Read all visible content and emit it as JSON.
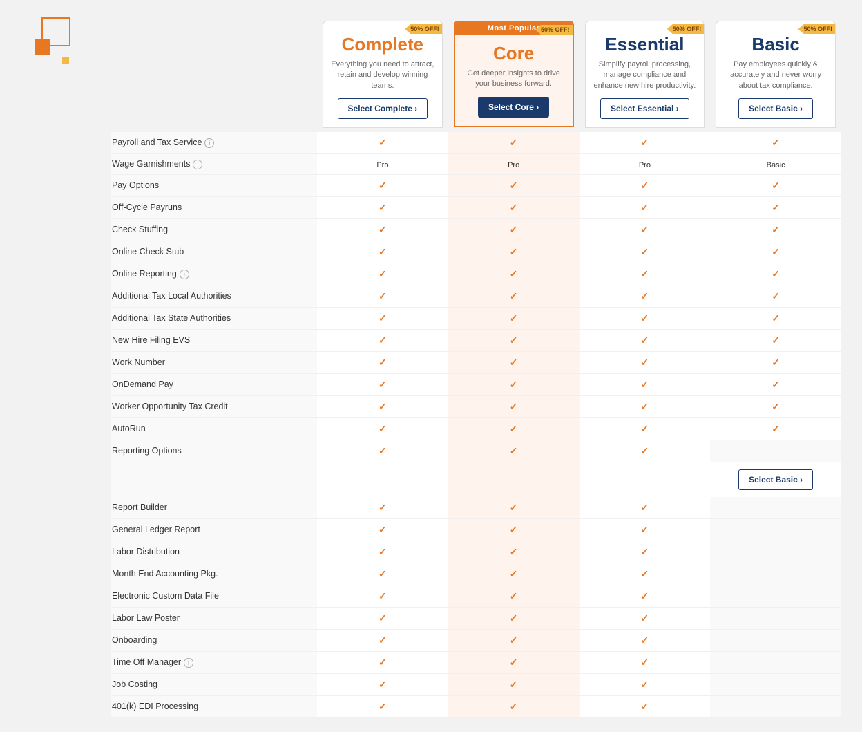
{
  "deco": {
    "visible": true
  },
  "plans": [
    {
      "id": "complete",
      "name": "Complete",
      "description": "Everything you need to attract, retain and develop winning teams.",
      "discount": "50% OFF!",
      "select_label": "Select Complete",
      "most_popular": false,
      "color": "orange"
    },
    {
      "id": "core",
      "name": "Core",
      "description": "Get deeper insights to drive your business forward.",
      "discount": "50% OFF!",
      "select_label": "Select Core",
      "most_popular": true,
      "color": "orange"
    },
    {
      "id": "essential",
      "name": "Essential",
      "description": "Simplify payroll processing, manage compliance and enhance new hire productivity.",
      "discount": "50% OFF!",
      "select_label": "Select Essential",
      "most_popular": false,
      "color": "navy"
    },
    {
      "id": "basic",
      "name": "Basic",
      "description": "Pay employees quickly & accurately and never worry about tax compliance.",
      "discount": "50% OFF!",
      "select_label": "Select Basic",
      "most_popular": false,
      "color": "navy"
    }
  ],
  "most_popular_label": "Most Popular",
  "features": [
    {
      "name": "Payroll and Tax Service",
      "info": true,
      "complete": "check",
      "core": "check",
      "essential": "check",
      "basic": "check"
    },
    {
      "name": "Wage Garnishments",
      "info": true,
      "complete": "Pro",
      "core": "Pro",
      "essential": "Pro",
      "basic": "Basic"
    },
    {
      "name": "Pay Options",
      "info": false,
      "complete": "check",
      "core": "check",
      "essential": "check",
      "basic": "check"
    },
    {
      "name": "Off-Cycle Payruns",
      "info": false,
      "complete": "check",
      "core": "check",
      "essential": "check",
      "basic": "check"
    },
    {
      "name": "Check Stuffing",
      "info": false,
      "complete": "check",
      "core": "check",
      "essential": "check",
      "basic": "check"
    },
    {
      "name": "Online Check Stub",
      "info": false,
      "complete": "check",
      "core": "check",
      "essential": "check",
      "basic": "check"
    },
    {
      "name": "Online Reporting",
      "info": true,
      "complete": "check",
      "core": "check",
      "essential": "check",
      "basic": "check"
    },
    {
      "name": "Additional Tax Local Authorities",
      "info": false,
      "complete": "check",
      "core": "check",
      "essential": "check",
      "basic": "check"
    },
    {
      "name": "Additional Tax State Authorities",
      "info": false,
      "complete": "check",
      "core": "check",
      "essential": "check",
      "basic": "check"
    },
    {
      "name": "New Hire Filing EVS",
      "info": false,
      "complete": "check",
      "core": "check",
      "essential": "check",
      "basic": "check"
    },
    {
      "name": "Work Number",
      "info": false,
      "complete": "check",
      "core": "check",
      "essential": "check",
      "basic": "check"
    },
    {
      "name": "OnDemand Pay",
      "info": false,
      "complete": "check",
      "core": "check",
      "essential": "check",
      "basic": "check"
    },
    {
      "name": "Worker Opportunity Tax Credit",
      "info": false,
      "complete": "check",
      "core": "check",
      "essential": "check",
      "basic": "check"
    },
    {
      "name": "AutoRun",
      "info": false,
      "complete": "check",
      "core": "check",
      "essential": "check",
      "basic": "check"
    },
    {
      "name": "Reporting Options",
      "info": false,
      "complete": "check",
      "core": "check",
      "essential": "check",
      "basic": ""
    },
    {
      "name": "Report Builder",
      "info": false,
      "complete": "check",
      "core": "check",
      "essential": "check",
      "basic": ""
    },
    {
      "name": "General Ledger Report",
      "info": false,
      "complete": "check",
      "core": "check",
      "essential": "check",
      "basic": ""
    },
    {
      "name": "Labor Distribution",
      "info": false,
      "complete": "check",
      "core": "check",
      "essential": "check",
      "basic": ""
    },
    {
      "name": "Month End Accounting Pkg.",
      "info": false,
      "complete": "check",
      "core": "check",
      "essential": "check",
      "basic": ""
    },
    {
      "name": "Electronic Custom Data File",
      "info": false,
      "complete": "check",
      "core": "check",
      "essential": "check",
      "basic": ""
    },
    {
      "name": "Labor Law Poster",
      "info": false,
      "complete": "check",
      "core": "check",
      "essential": "check",
      "basic": ""
    },
    {
      "name": "Onboarding",
      "info": false,
      "complete": "check",
      "core": "check",
      "essential": "check",
      "basic": ""
    },
    {
      "name": "Time Off Manager",
      "info": true,
      "complete": "check",
      "core": "check",
      "essential": "check",
      "basic": ""
    },
    {
      "name": "Job Costing",
      "info": false,
      "complete": "check",
      "core": "check",
      "essential": "check",
      "basic": ""
    },
    {
      "name": "401(k) EDI Processing",
      "info": false,
      "complete": "check",
      "core": "check",
      "essential": "check",
      "basic": ""
    }
  ],
  "select_basic_bottom_label": "Select Basic"
}
